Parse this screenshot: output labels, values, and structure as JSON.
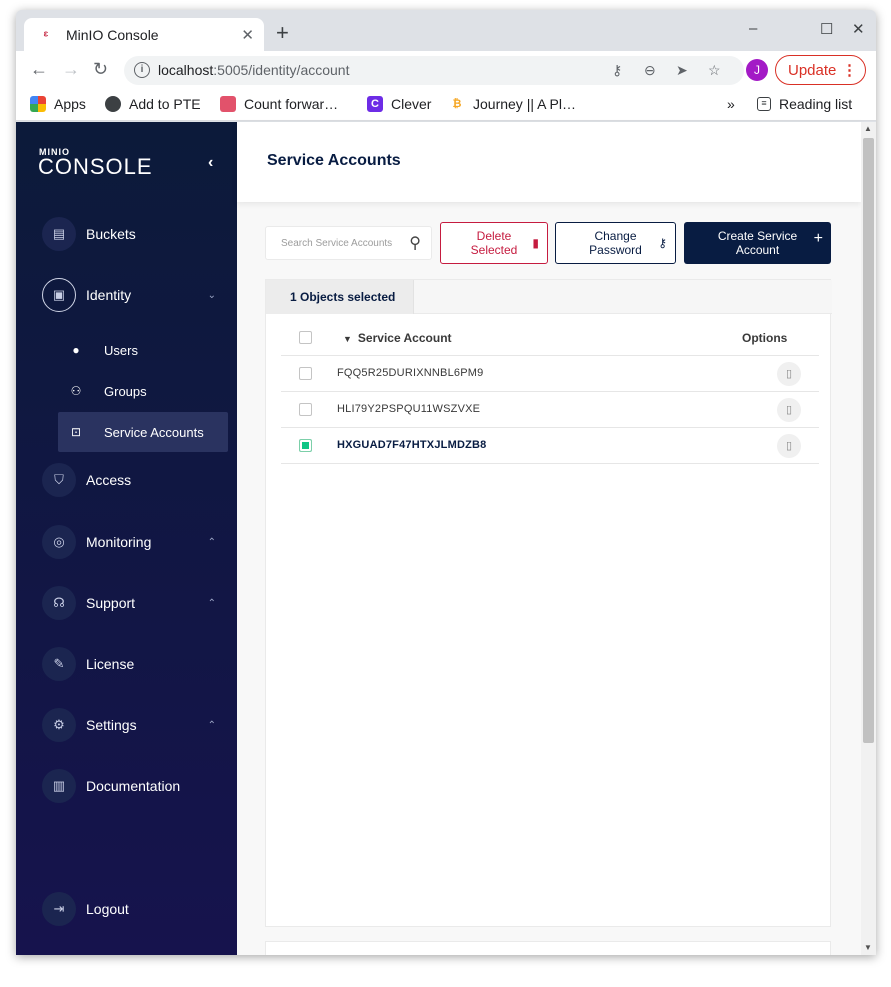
{
  "browser": {
    "tab_title": "MinIO Console",
    "tab_close": "✕",
    "new_tab": "+",
    "url_host": "localhost",
    "url_path": ":5005/identity/account",
    "profile_initial": "J",
    "update_label": "Update",
    "window_controls": [
      "–",
      "☐",
      "✕"
    ]
  },
  "bookmarks": {
    "items": [
      "Apps",
      "Add to PTE",
      "Count forwar…",
      "Clever",
      "Journey || A Pl…"
    ],
    "overflow": "»",
    "reading_list": "Reading list"
  },
  "sidebar": {
    "logo_small": "MINIO",
    "logo_big": "CONSOLE",
    "collapse": "‹",
    "items": [
      {
        "label": "Buckets"
      },
      {
        "label": "Identity"
      },
      {
        "label": "Access"
      },
      {
        "label": "Monitoring"
      },
      {
        "label": "Support"
      },
      {
        "label": "License"
      },
      {
        "label": "Settings"
      },
      {
        "label": "Documentation"
      },
      {
        "label": "Logout"
      }
    ],
    "identity_sub": [
      {
        "label": "Users"
      },
      {
        "label": "Groups"
      },
      {
        "label": "Service Accounts"
      }
    ]
  },
  "main": {
    "title": "Service Accounts",
    "search_placeholder": "Search Service Accounts",
    "delete_label": "Delete Selected",
    "change_label": "Change Password",
    "create_label": "Create Service Account",
    "selected_tab": "1 Objects selected",
    "table": {
      "col_account": "Service Account",
      "col_options": "Options",
      "rows": [
        {
          "account": "FQQ5R25DURIXNNBL6PM9",
          "checked": false
        },
        {
          "account": "HLI79Y2PSPQU11WSZVXE",
          "checked": false
        },
        {
          "account": "HXGUAD7F47HTXJLMDZB8",
          "checked": true
        }
      ]
    }
  },
  "colors": {
    "sidebar": "#0c1a3a",
    "accent": "#081c42",
    "danger": "#c51b3f",
    "checked": "#10c586"
  }
}
